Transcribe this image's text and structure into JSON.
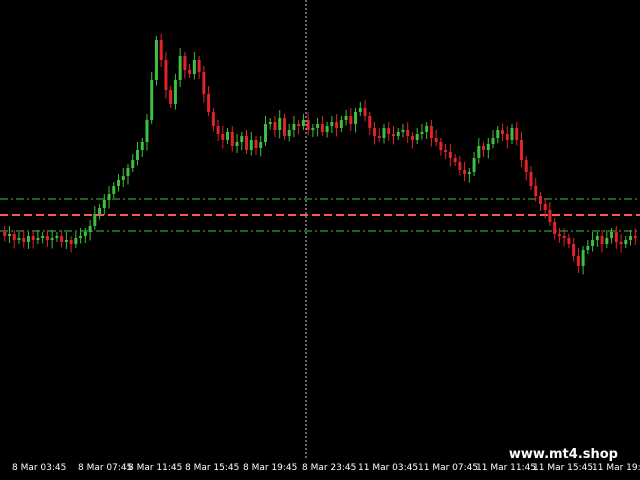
{
  "window": {
    "background": "#000000"
  },
  "colors": {
    "bull": "#3fbf3f",
    "bear": "#e0242a",
    "level_green": "#38c23a",
    "level_red": "#ff5555",
    "crosshair": "#d0d0d0",
    "axis_text": "#ffffff"
  },
  "chart_data": {
    "type": "candlestick",
    "x_tick_labels": [
      "8 Mar 03:45",
      "8 Mar 07:45",
      "8 Mar 11:45",
      "8 Mar 15:45",
      "8 Mar 19:45",
      "8 Mar 23:45",
      "11 Mar 03:45",
      "11 Mar 07:45",
      "11 Mar 11:45",
      "11 Mar 15:45",
      "11 Mar 19:45"
    ],
    "visible_time_labels": [
      "8 Mar 03:45",
      "8 Mar 07:45",
      "8 Mar 11:45",
      "8 Mar 15:45",
      "8 Mar 19:45",
      "8 Mar 23:45",
      "11 Mar 03:45",
      "11 Mar 07:45",
      "11 Mar 11:45",
      "11 Mar 15:45",
      "11 Mar 19:45"
    ],
    "horizontal_levels": [
      {
        "style": "dash-dot",
        "color": "#38c23a",
        "value": 199
      },
      {
        "style": "dashed",
        "color": "#ff5555",
        "value": 215
      },
      {
        "style": "dash-dot",
        "color": "#38c23a",
        "value": 231
      }
    ],
    "crosshair": {
      "vertical": true
    },
    "grid": false,
    "price_path": [
      232,
      236,
      234,
      240,
      238,
      242,
      236,
      240,
      238,
      236,
      240,
      238,
      236,
      242,
      240,
      244,
      238,
      236,
      232,
      226,
      214,
      208,
      200,
      194,
      186,
      180,
      176,
      168,
      160,
      150,
      142,
      120,
      80,
      40,
      60,
      90,
      104,
      80,
      56,
      70,
      74,
      60,
      72,
      94,
      112,
      126,
      134,
      140,
      132,
      146,
      142,
      136,
      150,
      140,
      148,
      142,
      124,
      122,
      130,
      118,
      136,
      130,
      124,
      126,
      120,
      130,
      128,
      124,
      132,
      126,
      122,
      128,
      120,
      116,
      124,
      112,
      108,
      116,
      128,
      136,
      138,
      128,
      134,
      136,
      132,
      130,
      136,
      140,
      134,
      132,
      126,
      138,
      142,
      150,
      152,
      158,
      162,
      170,
      174,
      172,
      158,
      146,
      150,
      144,
      138,
      130,
      134,
      140,
      128,
      140,
      160,
      172,
      186,
      196,
      204,
      210,
      222,
      234,
      236,
      238,
      244,
      256,
      266,
      250,
      246,
      240,
      236,
      244,
      238,
      232,
      242,
      244,
      240,
      236,
      238
    ]
  },
  "watermark": {
    "text": "www.mt4.shop"
  }
}
